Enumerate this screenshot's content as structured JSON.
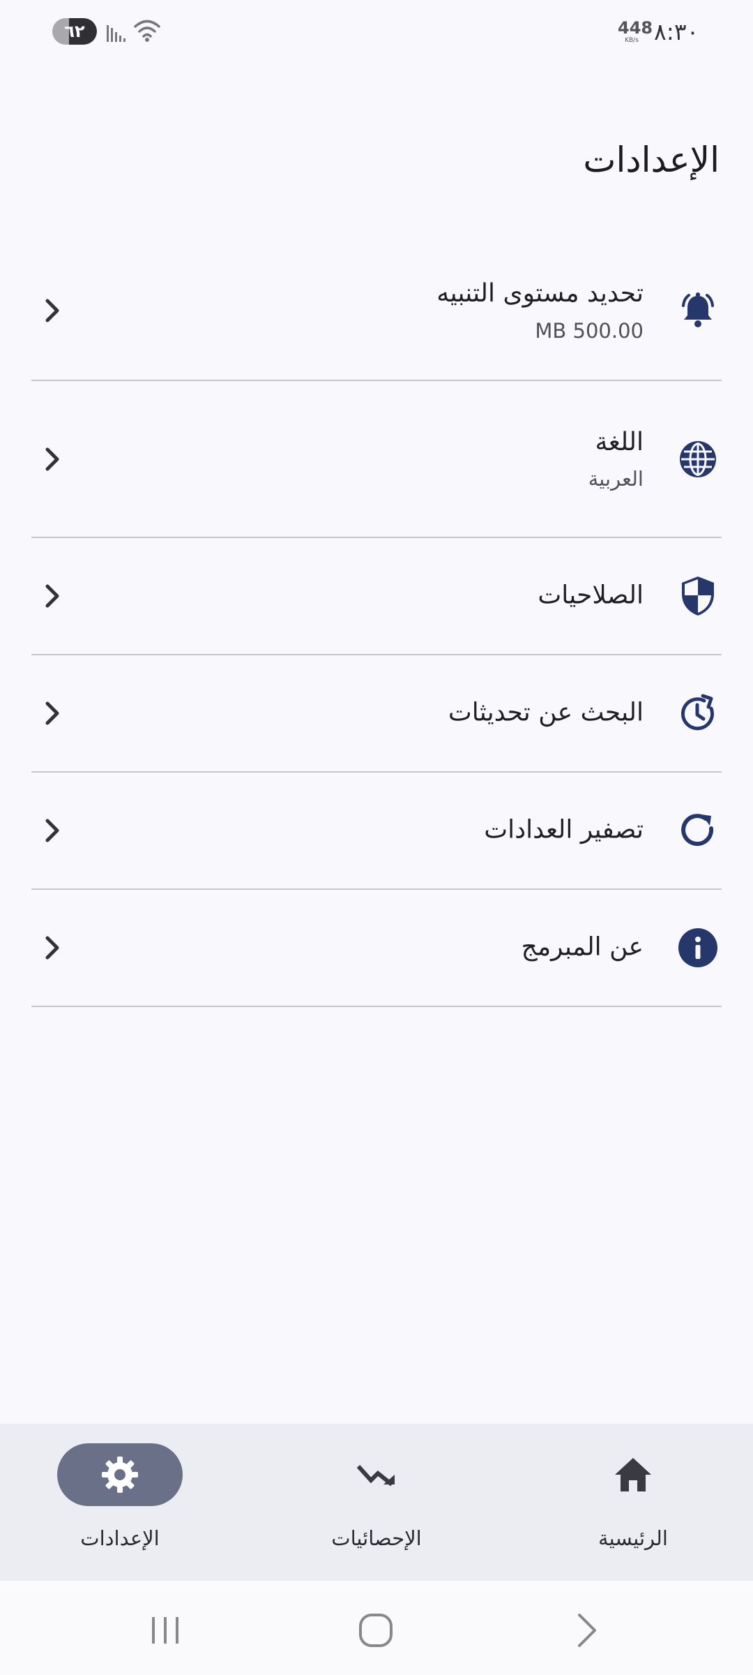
{
  "status_bar": {
    "battery": "٦٢",
    "battery_level": 0.62,
    "net_speed_value": "448",
    "net_speed_unit": "KB/s",
    "clock": "٨:٣٠"
  },
  "page": {
    "title": "الإعدادات"
  },
  "settings": [
    {
      "label": "تحديد مستوى التنبيه",
      "value": "MB 500.00",
      "icon": "bell-icon"
    },
    {
      "label": "اللغة",
      "value": "العربية",
      "icon": "globe-icon"
    },
    {
      "label": "الصلاحيات",
      "icon": "shield-icon"
    },
    {
      "label": "البحث عن تحديثات",
      "icon": "update-clock-icon"
    },
    {
      "label": "تصفير العدادات",
      "icon": "refresh-icon"
    },
    {
      "label": "عن المبرمج",
      "icon": "info-icon"
    }
  ],
  "bottom_nav": {
    "home": "الرئيسية",
    "stats": "الإحصائيات",
    "settings": "الإعدادات",
    "active": "settings"
  },
  "colors": {
    "accent": "#26386b",
    "nav_active": "#6b7089",
    "background": "#f8f8fd",
    "nav_background": "#ececf3"
  }
}
